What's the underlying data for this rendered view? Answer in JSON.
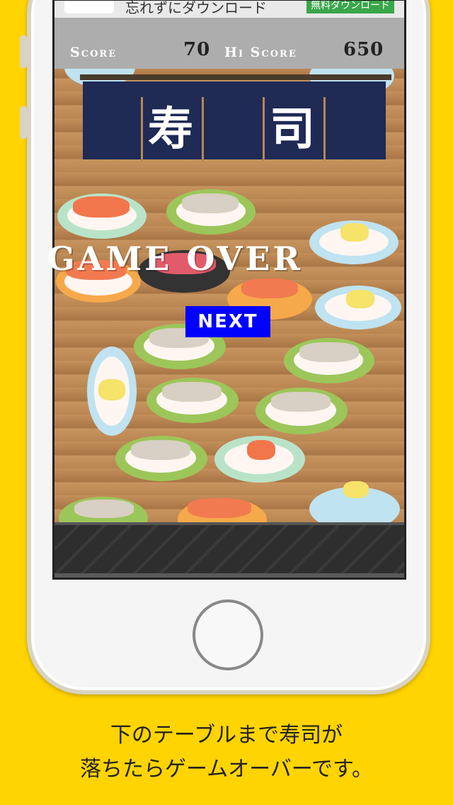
{
  "ad": {
    "text": "忘れずにダウンロード",
    "button": "無料ダウンロード"
  },
  "hud": {
    "score_label": "Score",
    "score_value": "70",
    "hiscore_label": "Hi Score",
    "hiscore_value": "650"
  },
  "banner": {
    "kanji_1": "寿",
    "kanji_2": "司"
  },
  "game": {
    "status": "GAME OVER",
    "next_label": "NEXT"
  },
  "caption": {
    "line1": "下のテーブルまで寿司が",
    "line2": "落ちたらゲームオーバーです。"
  },
  "colors": {
    "background": "#FFD400",
    "next_button": "#0000ff",
    "noren": "#1f2a55",
    "plate_green": "#9cc65a",
    "plate_blue": "#bfe3f0",
    "plate_orange": "#f6a94a",
    "plate_mint": "#b9e3c8"
  }
}
